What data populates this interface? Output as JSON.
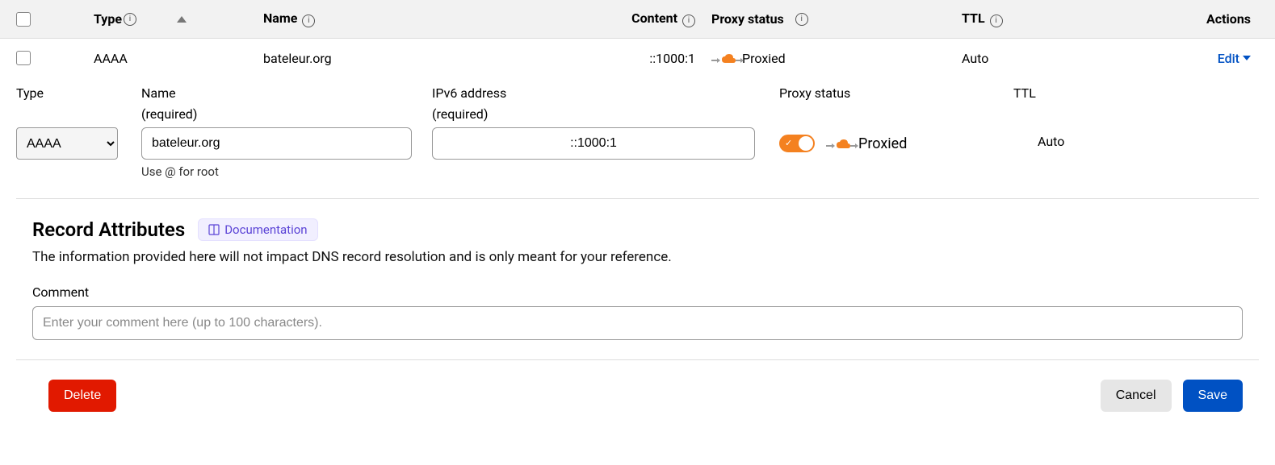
{
  "header": {
    "type": "Type",
    "name": "Name",
    "content": "Content",
    "proxy": "Proxy status",
    "ttl": "TTL",
    "actions": "Actions"
  },
  "row": {
    "type": "AAAA",
    "name": "bateleur.org",
    "content": "::1000:1",
    "proxy_text": "Proxied",
    "ttl": "Auto",
    "edit": "Edit"
  },
  "edit": {
    "type_label": "Type",
    "type_value": "AAAA",
    "name_label": "Name",
    "name_sub": "(required)",
    "name_value": "bateleur.org",
    "name_hint": "Use @ for root",
    "ipv6_label": "IPv6 address",
    "ipv6_sub": "(required)",
    "ipv6_value": "::1000:1",
    "proxy_label": "Proxy status",
    "proxy_text": "Proxied",
    "ttl_label": "TTL",
    "ttl_value": "Auto"
  },
  "attrs": {
    "title": "Record Attributes",
    "doc": "Documentation",
    "desc": "The information provided here will not impact DNS record resolution and is only meant for your reference.",
    "comment_label": "Comment",
    "comment_placeholder": "Enter your comment here (up to 100 characters)."
  },
  "buttons": {
    "delete": "Delete",
    "cancel": "Cancel",
    "save": "Save"
  },
  "colors": {
    "accent_orange": "#f48120",
    "accent_blue": "#0051c3",
    "danger": "#e11900",
    "doc_purple": "#5b44d6"
  }
}
